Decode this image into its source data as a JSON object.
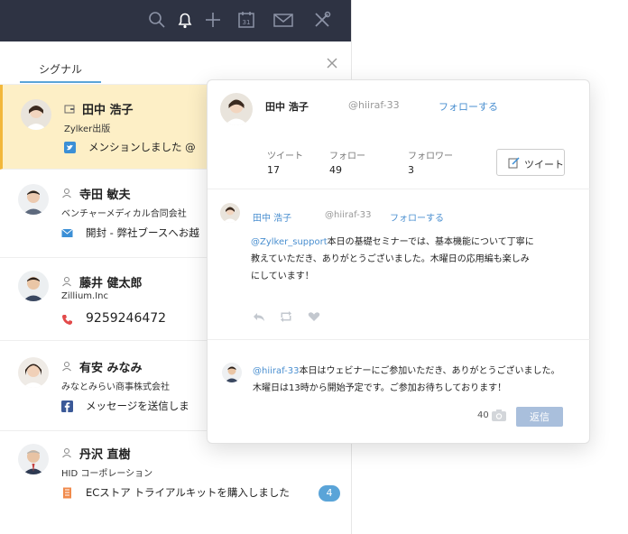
{
  "topbar": {
    "icons": [
      "search-icon",
      "bell-icon",
      "plus-icon",
      "calendar-icon",
      "mail-icon",
      "tools-icon"
    ],
    "calendar_day": "31"
  },
  "tabs": [
    {
      "label": "シグナル"
    }
  ],
  "signals": [
    {
      "name": "田中 浩子",
      "company": "Zylker出版",
      "channel": "twitter",
      "message": "メンションしました @",
      "active": true
    },
    {
      "name": "寺田 敏夫",
      "company": "ベンチャーメディカル合同会社",
      "channel": "email",
      "message": "開封 - 弊社ブースへお越"
    },
    {
      "name": "藤井 健太郎",
      "company": "Zillium.Inc",
      "channel": "phone",
      "message": "9259246472"
    },
    {
      "name": "有安 みなみ",
      "company": "みなとみらい商事株式会社",
      "channel": "facebook",
      "message": "メッセージを送信しま"
    },
    {
      "name": "丹沢 直樹",
      "company": "HID コーポレーション",
      "channel": "web",
      "message": "ECストア トライアルキットを購入しました",
      "badge": "4"
    }
  ],
  "card": {
    "profile": {
      "name": "田中 浩子",
      "handle": "@hiiraf-33",
      "follow": "フォローする"
    },
    "stats": [
      {
        "label": "ツイート",
        "value": "17"
      },
      {
        "label": "フォロー",
        "value": "49"
      },
      {
        "label": "フォロワー",
        "value": "3"
      }
    ],
    "tweet_button": "ツイート",
    "tweet": {
      "name": "田中 浩子",
      "handle": "@hiiraf-33",
      "follow": "フォローする",
      "mention": "@Zylker_support",
      "line1": "本日の基礎セミナーでは、基本機能について丁寧に",
      "line2": "教えていただき、ありがとうございました。木曜日の応用編も楽しみ",
      "line3": "にしています！"
    },
    "reply": {
      "mention": "@hiiraf-33",
      "line1": "本日はウェビナーにご参加いただき、ありがとうございました。",
      "line2": "木曜日は13時から開始予定です。ご参加お待ちしております！",
      "count": "40",
      "button": "返信"
    }
  }
}
